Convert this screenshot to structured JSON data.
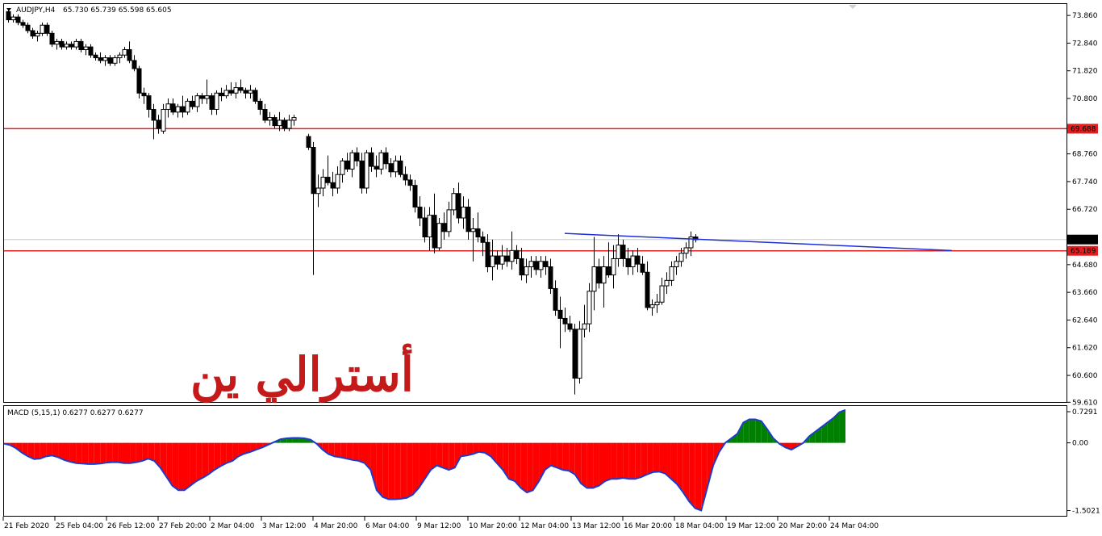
{
  "header": {
    "symbol": "AUDJPY,H4",
    "ohlc": "65.730 65.739 65.598 65.605"
  },
  "watermark_text": "أسترالي ين",
  "colors": {
    "bull_fill": "#ffffff",
    "bear_fill": "#000000",
    "candle_outline": "#000000",
    "horizontal_level": "#e02020",
    "trendline": "#1e2fd6",
    "macd_negative": "#ff0000",
    "macd_positive": "#008000",
    "macd_line": "#1e3ccc",
    "price_tag_bg": "#000000",
    "level_tag_bg": "#e02020",
    "watermark": "#c41a1a"
  },
  "chart_data": [
    {
      "type": "candlestick",
      "symbol": "AUDJPY",
      "timeframe": "H4",
      "ylim": [
        59.65,
        74.25
      ],
      "y_ticks": [
        "73.860",
        "72.840",
        "71.820",
        "70.800",
        "68.760",
        "67.740",
        "66.720",
        "64.680",
        "63.660",
        "62.640",
        "61.620",
        "60.600",
        "59.610"
      ],
      "x_ticks": [
        "21 Feb 2020",
        "25 Feb 04:00",
        "26 Feb 12:00",
        "27 Feb 20:00",
        "2 Mar 04:00",
        "3 Mar 12:00",
        "4 Mar 20:00",
        "6 Mar 04:00",
        "9 Mar 12:00",
        "10 Mar 20:00",
        "12 Mar 04:00",
        "13 Mar 12:00",
        "16 Mar 20:00",
        "18 Mar 04:00",
        "19 Mar 12:00",
        "20 Mar 20:00",
        "24 Mar 04:00"
      ],
      "horizontal_levels": [
        {
          "value": 69.688,
          "label": "69.688"
        },
        {
          "value": 65.189,
          "label": "65.189"
        }
      ],
      "current_price": {
        "value": 65.605,
        "label": "65.605"
      },
      "trendline": {
        "from": [
          113,
          65.83
        ],
        "to": [
          193,
          65.2
        ]
      },
      "ohlc": [
        [
          74.0,
          74.1,
          73.6,
          73.7
        ],
        [
          73.7,
          73.9,
          73.6,
          73.8
        ],
        [
          73.8,
          73.9,
          73.5,
          73.6
        ],
        [
          73.6,
          73.7,
          73.4,
          73.5
        ],
        [
          73.5,
          73.6,
          73.2,
          73.3
        ],
        [
          73.3,
          73.4,
          73.0,
          73.1
        ],
        [
          73.1,
          73.3,
          72.9,
          73.2
        ],
        [
          73.2,
          73.6,
          73.1,
          73.5
        ],
        [
          73.5,
          73.6,
          73.1,
          73.2
        ],
        [
          73.2,
          73.3,
          72.7,
          72.8
        ],
        [
          72.8,
          73.0,
          72.6,
          72.9
        ],
        [
          72.9,
          73.0,
          72.6,
          72.7
        ],
        [
          72.7,
          72.9,
          72.6,
          72.8
        ],
        [
          72.8,
          72.9,
          72.6,
          72.7
        ],
        [
          72.7,
          73.0,
          72.6,
          72.9
        ],
        [
          72.9,
          73.0,
          72.5,
          72.6
        ],
        [
          72.6,
          72.8,
          72.4,
          72.7
        ],
        [
          72.7,
          72.8,
          72.3,
          72.4
        ],
        [
          72.4,
          72.5,
          72.2,
          72.3
        ],
        [
          72.3,
          72.5,
          72.1,
          72.2
        ],
        [
          72.2,
          72.4,
          72.0,
          72.3
        ],
        [
          72.3,
          72.4,
          72.0,
          72.1
        ],
        [
          72.1,
          72.4,
          72.0,
          72.3
        ],
        [
          72.3,
          72.5,
          72.1,
          72.4
        ],
        [
          72.4,
          72.7,
          72.3,
          72.6
        ],
        [
          72.6,
          72.9,
          72.1,
          72.2
        ],
        [
          72.2,
          72.4,
          71.8,
          71.9
        ],
        [
          71.9,
          72.0,
          70.8,
          71.0
        ],
        [
          71.0,
          71.2,
          70.6,
          70.9
        ],
        [
          70.9,
          71.0,
          70.1,
          70.4
        ],
        [
          70.4,
          70.6,
          69.3,
          70.0
        ],
        [
          70.0,
          70.2,
          69.5,
          69.7
        ],
        [
          69.6,
          70.6,
          69.5,
          70.4
        ],
        [
          70.4,
          70.8,
          70.1,
          70.6
        ],
        [
          70.6,
          70.8,
          70.2,
          70.3
        ],
        [
          70.3,
          70.6,
          70.1,
          70.5
        ],
        [
          70.5,
          70.9,
          70.1,
          70.3
        ],
        [
          70.3,
          70.8,
          70.2,
          70.7
        ],
        [
          70.7,
          70.9,
          70.4,
          70.5
        ],
        [
          70.5,
          71.0,
          70.3,
          70.9
        ],
        [
          70.9,
          71.0,
          70.6,
          70.8
        ],
        [
          70.8,
          71.5,
          70.6,
          70.9
        ],
        [
          70.9,
          71.0,
          70.2,
          70.4
        ],
        [
          70.4,
          71.1,
          70.2,
          71.0
        ],
        [
          71.0,
          71.2,
          70.7,
          70.9
        ],
        [
          70.9,
          71.3,
          70.8,
          71.1
        ],
        [
          71.1,
          71.4,
          70.9,
          71.0
        ],
        [
          71.0,
          71.4,
          70.8,
          71.2
        ],
        [
          71.2,
          71.5,
          71.0,
          71.1
        ],
        [
          71.1,
          71.2,
          70.8,
          71.0
        ],
        [
          71.0,
          71.3,
          70.8,
          71.1
        ],
        [
          71.1,
          71.2,
          70.6,
          70.7
        ],
        [
          70.7,
          70.8,
          70.2,
          70.4
        ],
        [
          70.4,
          70.6,
          69.9,
          70.0
        ],
        [
          70.0,
          70.3,
          69.8,
          70.1
        ],
        [
          70.1,
          70.2,
          69.7,
          69.8
        ],
        [
          69.8,
          70.3,
          69.6,
          70.0
        ],
        [
          70.0,
          70.1,
          69.6,
          69.7
        ],
        [
          69.7,
          70.2,
          69.6,
          70.0
        ],
        [
          70.0,
          70.2,
          69.8,
          70.1
        ],
        [
          69.4,
          69.5,
          68.9,
          69.0
        ],
        [
          69.0,
          69.2,
          64.3,
          67.3
        ],
        [
          67.3,
          68.0,
          66.8,
          67.5
        ],
        [
          67.5,
          68.2,
          67.2,
          67.9
        ],
        [
          67.9,
          68.7,
          67.6,
          67.7
        ],
        [
          67.7,
          68.1,
          67.2,
          67.5
        ],
        [
          67.5,
          68.3,
          67.3,
          68.0
        ],
        [
          68.0,
          68.6,
          67.7,
          68.5
        ],
        [
          68.5,
          68.8,
          68.1,
          68.2
        ],
        [
          68.2,
          68.9,
          67.9,
          68.8
        ],
        [
          68.8,
          69.0,
          68.3,
          68.5
        ],
        [
          68.5,
          68.8,
          67.3,
          67.5
        ],
        [
          67.5,
          68.9,
          67.3,
          68.8
        ],
        [
          68.8,
          69.0,
          68.1,
          68.3
        ],
        [
          68.3,
          68.7,
          67.9,
          68.2
        ],
        [
          68.2,
          68.9,
          68.0,
          68.8
        ],
        [
          68.8,
          69.0,
          68.2,
          68.4
        ],
        [
          68.4,
          68.6,
          67.9,
          68.1
        ],
        [
          68.1,
          68.7,
          67.9,
          68.5
        ],
        [
          68.5,
          68.7,
          67.9,
          68.0
        ],
        [
          68.0,
          68.3,
          67.6,
          67.8
        ],
        [
          67.8,
          68.0,
          67.4,
          67.6
        ],
        [
          67.6,
          67.8,
          66.6,
          66.8
        ],
        [
          66.8,
          67.2,
          66.1,
          66.4
        ],
        [
          66.4,
          66.8,
          65.5,
          65.7
        ],
        [
          65.7,
          66.8,
          65.2,
          66.5
        ],
        [
          66.5,
          67.3,
          65.1,
          65.3
        ],
        [
          65.3,
          66.4,
          65.2,
          66.2
        ],
        [
          66.2,
          66.6,
          65.6,
          65.9
        ],
        [
          65.9,
          67.0,
          65.7,
          66.7
        ],
        [
          66.7,
          67.5,
          66.5,
          67.3
        ],
        [
          67.3,
          67.7,
          66.2,
          66.4
        ],
        [
          66.4,
          67.2,
          66.0,
          66.8
        ],
        [
          66.8,
          67.1,
          65.6,
          65.9
        ],
        [
          65.9,
          66.4,
          64.8,
          66.0
        ],
        [
          66.0,
          66.6,
          65.5,
          65.7
        ],
        [
          65.7,
          65.9,
          65.0,
          65.5
        ],
        [
          65.5,
          65.8,
          64.4,
          64.6
        ],
        [
          64.6,
          65.6,
          64.1,
          65.0
        ],
        [
          65.0,
          65.2,
          64.5,
          64.7
        ],
        [
          64.7,
          65.4,
          64.5,
          65.0
        ],
        [
          65.0,
          65.3,
          64.6,
          64.8
        ],
        [
          64.8,
          65.9,
          64.5,
          65.2
        ],
        [
          65.2,
          65.4,
          64.7,
          64.9
        ],
        [
          64.9,
          65.3,
          64.1,
          64.3
        ],
        [
          64.3,
          64.9,
          64.0,
          64.6
        ],
        [
          64.6,
          65.0,
          64.2,
          64.8
        ],
        [
          64.8,
          65.0,
          64.3,
          64.5
        ],
        [
          64.5,
          65.0,
          64.2,
          64.8
        ],
        [
          64.8,
          65.0,
          64.3,
          64.6
        ],
        [
          64.6,
          64.9,
          63.6,
          63.8
        ],
        [
          63.8,
          64.1,
          62.8,
          63.0
        ],
        [
          63.0,
          63.5,
          61.6,
          62.7
        ],
        [
          62.7,
          63.1,
          62.2,
          62.5
        ],
        [
          62.5,
          62.8,
          62.2,
          62.3
        ],
        [
          62.3,
          62.5,
          59.9,
          60.5
        ],
        [
          60.5,
          62.6,
          60.3,
          62.3
        ],
        [
          62.3,
          63.2,
          62.0,
          62.5
        ],
        [
          62.5,
          64.0,
          62.2,
          63.7
        ],
        [
          63.7,
          65.7,
          63.0,
          64.6
        ],
        [
          64.6,
          64.9,
          63.8,
          64.0
        ],
        [
          64.0,
          65.0,
          63.1,
          64.6
        ],
        [
          64.6,
          65.5,
          64.2,
          64.3
        ],
        [
          64.3,
          65.4,
          63.8,
          64.9
        ],
        [
          64.9,
          65.8,
          64.6,
          65.4
        ],
        [
          65.4,
          65.6,
          64.6,
          64.9
        ],
        [
          64.9,
          65.3,
          64.3,
          64.6
        ],
        [
          64.6,
          65.2,
          64.3,
          65.0
        ],
        [
          65.0,
          65.3,
          64.4,
          64.7
        ],
        [
          64.7,
          65.0,
          64.3,
          64.4
        ],
        [
          64.4,
          64.8,
          63.0,
          63.1
        ],
        [
          63.1,
          63.4,
          62.8,
          63.2
        ],
        [
          63.2,
          63.6,
          62.9,
          63.3
        ],
        [
          63.3,
          64.2,
          63.2,
          63.9
        ],
        [
          63.9,
          64.4,
          63.6,
          64.1
        ],
        [
          64.1,
          64.8,
          63.9,
          64.6
        ],
        [
          64.6,
          65.0,
          64.3,
          64.8
        ],
        [
          64.8,
          65.3,
          64.6,
          65.1
        ],
        [
          65.1,
          65.5,
          64.9,
          65.3
        ],
        [
          65.3,
          65.9,
          65.0,
          65.7
        ],
        [
          65.7,
          65.8,
          65.5,
          65.6
        ]
      ]
    },
    {
      "type": "area",
      "title": "MACD (5,15,1) 0.6277 0.6277 0.6277",
      "ylim": [
        -1.6,
        0.78
      ],
      "y_ticks": [
        "0.7291",
        "0.00",
        "-1.5021"
      ],
      "values": [
        -0.02,
        -0.05,
        -0.12,
        -0.22,
        -0.3,
        -0.36,
        -0.35,
        -0.3,
        -0.28,
        -0.32,
        -0.38,
        -0.42,
        -0.45,
        -0.46,
        -0.47,
        -0.47,
        -0.46,
        -0.44,
        -0.43,
        -0.43,
        -0.45,
        -0.45,
        -0.43,
        -0.4,
        -0.35,
        -0.4,
        -0.55,
        -0.75,
        -0.95,
        -1.05,
        -1.05,
        -0.95,
        -0.85,
        -0.78,
        -0.7,
        -0.6,
        -0.52,
        -0.45,
        -0.4,
        -0.3,
        -0.24,
        -0.2,
        -0.15,
        -0.1,
        -0.04,
        0.02,
        0.08,
        0.1,
        0.11,
        0.11,
        0.1,
        0.07,
        -0.02,
        -0.15,
        -0.25,
        -0.3,
        -0.32,
        -0.35,
        -0.38,
        -0.4,
        -0.45,
        -0.6,
        -1.05,
        -1.2,
        -1.25,
        -1.25,
        -1.24,
        -1.22,
        -1.15,
        -1.0,
        -0.8,
        -0.6,
        -0.5,
        -0.55,
        -0.6,
        -0.55,
        -0.3,
        -0.28,
        -0.25,
        -0.2,
        -0.22,
        -0.3,
        -0.45,
        -0.6,
        -0.8,
        -0.85,
        -1.0,
        -1.1,
        -1.05,
        -0.85,
        -0.6,
        -0.5,
        -0.55,
        -0.6,
        -0.62,
        -0.7,
        -0.9,
        -1.0,
        -1.0,
        -0.95,
        -0.85,
        -0.8,
        -0.8,
        -0.78,
        -0.8,
        -0.8,
        -0.76,
        -0.7,
        -0.65,
        -0.64,
        -0.68,
        -0.8,
        -0.92,
        -1.1,
        -1.3,
        -1.45,
        -1.5,
        -1.0,
        -0.5,
        -0.2,
        0.0,
        0.1,
        0.2,
        0.45,
        0.52,
        0.52,
        0.48,
        0.3,
        0.1,
        -0.02,
        -0.1,
        -0.15,
        -0.08,
        0.0,
        0.15,
        0.25,
        0.35,
        0.45,
        0.55,
        0.68,
        0.73
      ]
    }
  ]
}
